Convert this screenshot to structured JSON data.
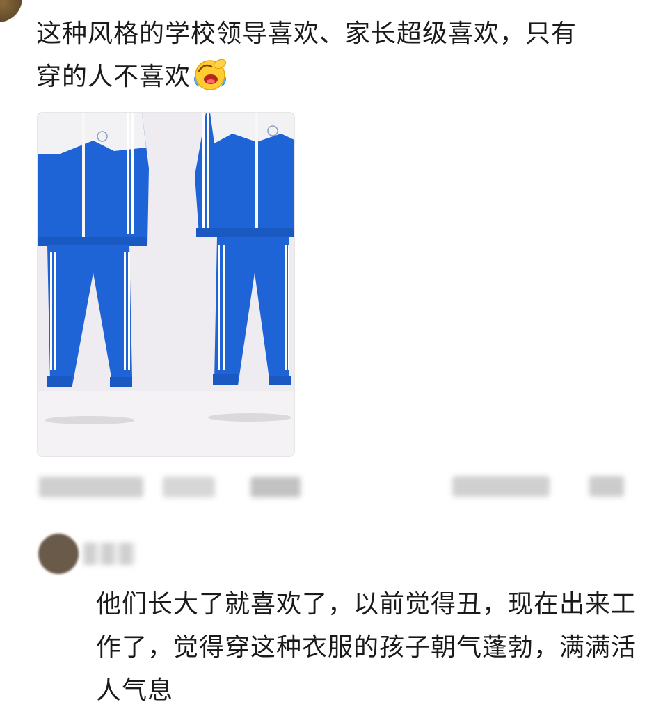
{
  "post": {
    "text": "这种风格的学校领导喜欢、家长超级喜欢，只有穿的人不喜欢",
    "emoji": "laughing-crying-emoji"
  },
  "comment": {
    "text": "他们长大了就喜欢了，以前觉得丑，现在出来工作了，觉得穿这种衣服的孩子朝气蓬勃，满满活人气息"
  },
  "colors": {
    "uniform_blue": "#1f64d6",
    "stripe_white": "#ffffff",
    "background": "#ffffff"
  }
}
